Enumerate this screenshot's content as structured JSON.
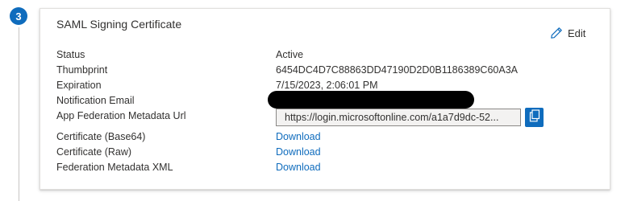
{
  "step": {
    "number": "3"
  },
  "card": {
    "title": "SAML Signing Certificate",
    "edit_label": "Edit",
    "fields": {
      "status": {
        "label": "Status",
        "value": "Active"
      },
      "thumbprint": {
        "label": "Thumbprint",
        "value": "6454DC4D7C88863DD47190D2D0B1186389C60A3A"
      },
      "expiration": {
        "label": "Expiration",
        "value": "7/15/2023, 2:06:01 PM"
      },
      "notification_email": {
        "label": "Notification Email",
        "value": ""
      },
      "metadata_url": {
        "label": "App Federation Metadata Url",
        "value": "https://login.microsoftonline.com/a1a7d9dc-52..."
      },
      "cert_base64": {
        "label": "Certificate (Base64)",
        "link": "Download"
      },
      "cert_raw": {
        "label": "Certificate (Raw)",
        "link": "Download"
      },
      "federation_xml": {
        "label": "Federation Metadata XML",
        "link": "Download"
      }
    }
  },
  "icons": {
    "edit": "pencil-icon",
    "copy": "copy-icon"
  },
  "colors": {
    "accent": "#0f6cbd",
    "text": "#323130",
    "border": "#e1dfdd"
  }
}
